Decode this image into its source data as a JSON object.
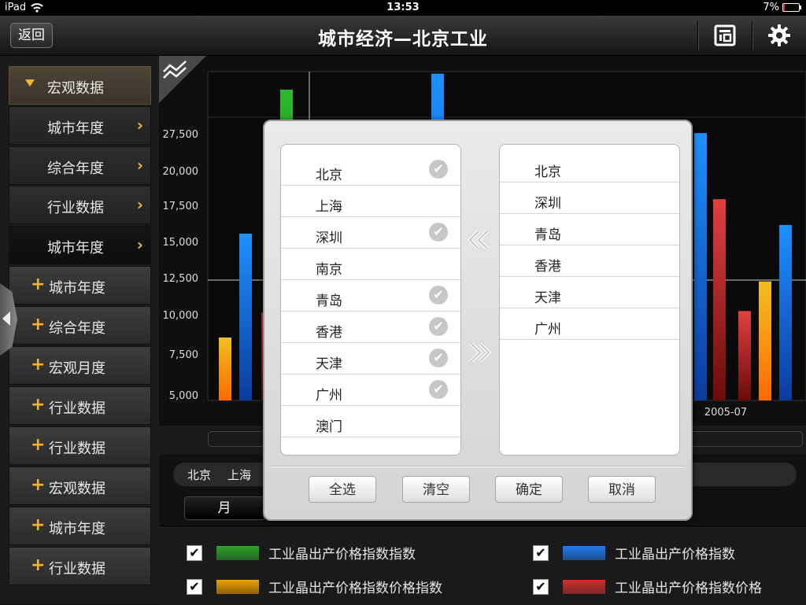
{
  "status_bar": {
    "device": "iPad",
    "time": "13:53",
    "battery": "7%"
  },
  "nav": {
    "back": "返回",
    "title": "城市经济—北京工业"
  },
  "sidebar": {
    "items": [
      {
        "label": "宏观数据",
        "kind": "header"
      },
      {
        "label": "城市年度",
        "kind": "sub"
      },
      {
        "label": "综合年度",
        "kind": "sub"
      },
      {
        "label": "行业数据",
        "kind": "sub"
      },
      {
        "label": "城市年度",
        "kind": "sub-active"
      },
      {
        "label": "城市年度",
        "kind": "plus"
      },
      {
        "label": "综合年度",
        "kind": "plus"
      },
      {
        "label": "宏观月度",
        "kind": "plus"
      },
      {
        "label": "行业数据",
        "kind": "plus"
      },
      {
        "label": "行业数据",
        "kind": "plus"
      },
      {
        "label": "宏观数据",
        "kind": "plus"
      },
      {
        "label": "城市年度",
        "kind": "plus"
      },
      {
        "label": "行业数据",
        "kind": "plus"
      }
    ]
  },
  "chart_data": {
    "type": "bar",
    "y_ticks": [
      "27,500",
      "20,000",
      "17,500",
      "15,000",
      "12,500",
      "10,000",
      "7,500",
      "5,000"
    ],
    "y_values": [
      27500,
      20000,
      17500,
      15000,
      12500,
      10000,
      7500,
      5000
    ],
    "x_labels": [
      "2005-07"
    ],
    "grid": true,
    "bars": [
      {
        "value": 8600,
        "color": "#f0c020",
        "color2": "#ff6a00"
      },
      {
        "value": 15600,
        "color": "#1e90ff",
        "color2": "#0b3c9c"
      },
      {
        "value": 10200,
        "color": "#e04040",
        "color2": "#6a0b0b"
      },
      {
        "value": 30600,
        "color": "#2db82d",
        "color2": "#0b5c0b"
      },
      {
        "value": 31700,
        "color": "#1e90ff",
        "color2": "#0b3c9c"
      },
      {
        "value": 27600,
        "color": "#1e90ff",
        "color2": "#0b3c9c"
      },
      {
        "value": 18000,
        "color": "#e04040",
        "color2": "#6a0b0b"
      },
      {
        "value": 10300,
        "color": "#e04040",
        "color2": "#6a0b0b"
      },
      {
        "value": 12300,
        "color": "#f0c020",
        "color2": "#ff6a00"
      },
      {
        "value": 16200,
        "color": "#1e90ff",
        "color2": "#0b3c9c"
      }
    ]
  },
  "city_strip": [
    "北京",
    "上海"
  ],
  "month_tab": "月",
  "legend": [
    {
      "label": "工业晶出产价格指数指数",
      "color": "#2aa52a",
      "checked": "✔"
    },
    {
      "label": "工业晶出产价格指数",
      "color": "#1e7cf0",
      "checked": "✔"
    },
    {
      "label": "工业晶出产价格指数价格指数",
      "color": "#f0a000",
      "checked": "✔"
    },
    {
      "label": "工业晶出产价格指数价格",
      "color": "#d03030",
      "checked": "✔"
    }
  ],
  "dialog": {
    "left_list": [
      {
        "name": "北京",
        "checked": true
      },
      {
        "name": "上海",
        "checked": false
      },
      {
        "name": "深圳",
        "checked": true
      },
      {
        "name": "南京",
        "checked": false
      },
      {
        "name": "青岛",
        "checked": true
      },
      {
        "name": "香港",
        "checked": true
      },
      {
        "name": "天津",
        "checked": true
      },
      {
        "name": "广州",
        "checked": true
      },
      {
        "name": "澳门",
        "checked": false
      }
    ],
    "right_list": [
      "北京",
      "深圳",
      "青岛",
      "香港",
      "天津",
      "广州"
    ],
    "check_glyph": "✔",
    "buttons": {
      "select_all": "全选",
      "clear": "清空",
      "confirm": "确定",
      "cancel": "取消"
    }
  }
}
